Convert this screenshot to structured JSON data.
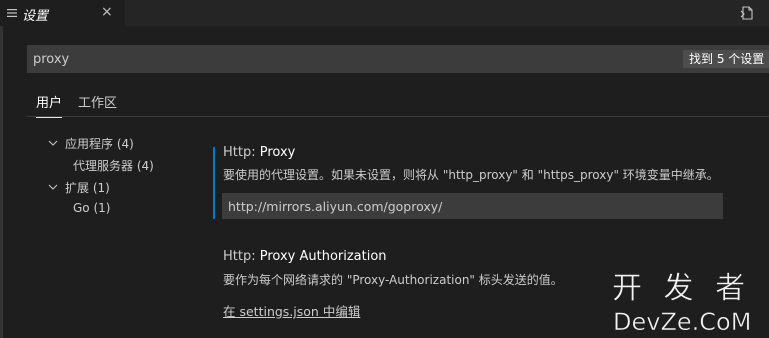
{
  "tab": {
    "title": "设置",
    "close": "×",
    "icon": "settings-list-icon"
  },
  "toolbar": {
    "split_icon": "open-settings-json-icon"
  },
  "search": {
    "value": "proxy",
    "result_label": "找到 5 个设置"
  },
  "scopes": [
    {
      "label": "用户",
      "active": true
    },
    {
      "label": "工作区",
      "active": false
    }
  ],
  "toc": [
    {
      "label": "应用程序 (4)",
      "expanded": true
    },
    {
      "label": "代理服务器 (4)"
    },
    {
      "label": "扩展 (1)",
      "expanded": true
    },
    {
      "label": "Go (1)"
    }
  ],
  "settings": [
    {
      "category": "Http: ",
      "name": "Proxy",
      "description": "要使用的代理设置。如果未设置，则将从 \"http_proxy\" 和 \"https_proxy\" 环境变量中继承。",
      "value": "http://mirrors.aliyun.com/goproxy/"
    },
    {
      "category": "Http: ",
      "name": "Proxy Authorization",
      "description": "要作为每个网络请求的 \"Proxy-Authorization\" 标头发送的值。",
      "link": "在 settings.json 中编辑"
    }
  ],
  "watermark": {
    "line1": "开 发 者",
    "line2": "DevZe.CoM"
  },
  "colors": {
    "accent": "#007acc",
    "background": "#1e1e1e",
    "input": "#3c3c3c"
  }
}
